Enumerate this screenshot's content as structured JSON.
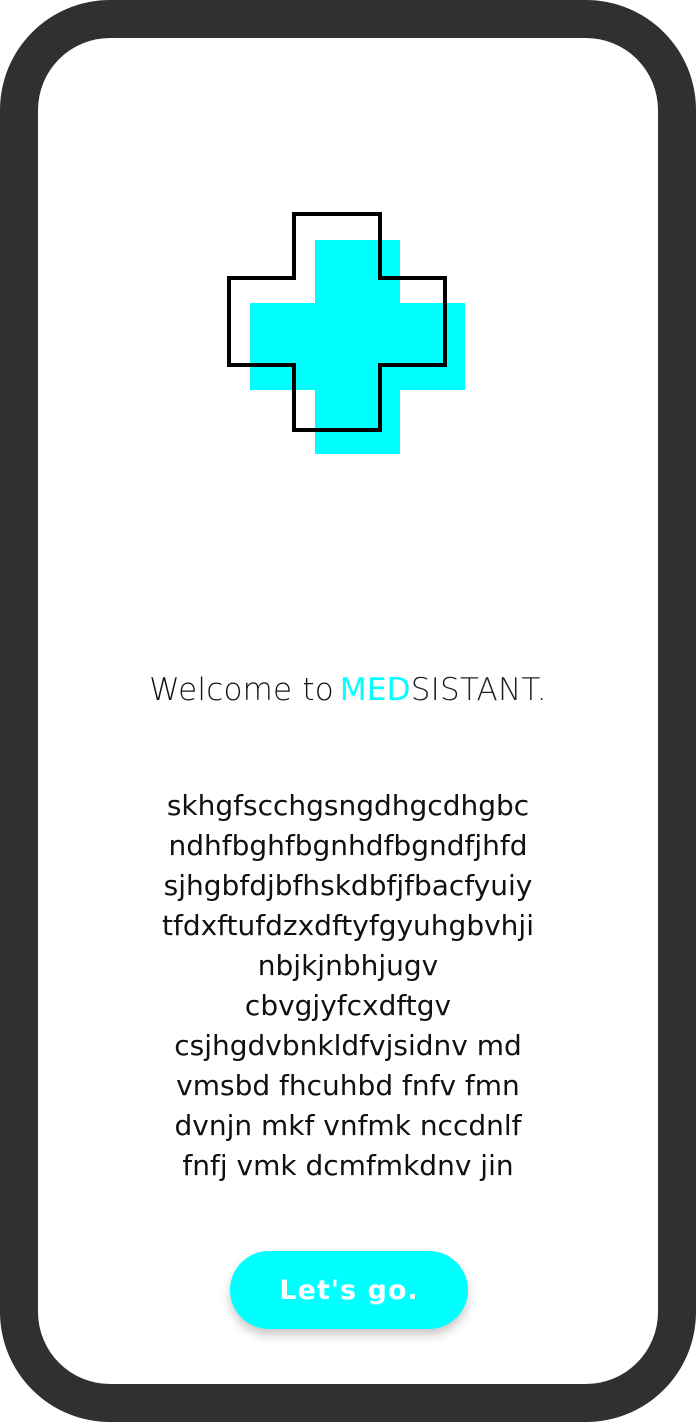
{
  "welcome": {
    "prefix": "Welcome to",
    "brand_accent": "MED",
    "brand_rest": "SISTANT."
  },
  "body_lines": [
    "skhgfscchgsngdhgcdhgbc",
    "ndhfbghfbgnhdfbgndfjhfd",
    "sjhgbfdjbfhskdbfjfbacfyuiy",
    "tfdxftufdzxdftyfgyuhgbvhji",
    "nbjkjnbhjugv",
    "cbvgjyfcxdftgv",
    "csjhgdvbnkldfvjsidnv md",
    "vmsbd fhcuhbd fnfv fmn",
    "dvnjn mkf vnfmk nccdnlf",
    "fnfj vmk dcmfmkdnv jin"
  ],
  "cta": {
    "label": "Let's go."
  },
  "colors": {
    "accent": "#00ffff",
    "frame": "#2f3032",
    "screen": "#ffffff"
  },
  "icons": {
    "logo": "medical-cross-icon"
  }
}
